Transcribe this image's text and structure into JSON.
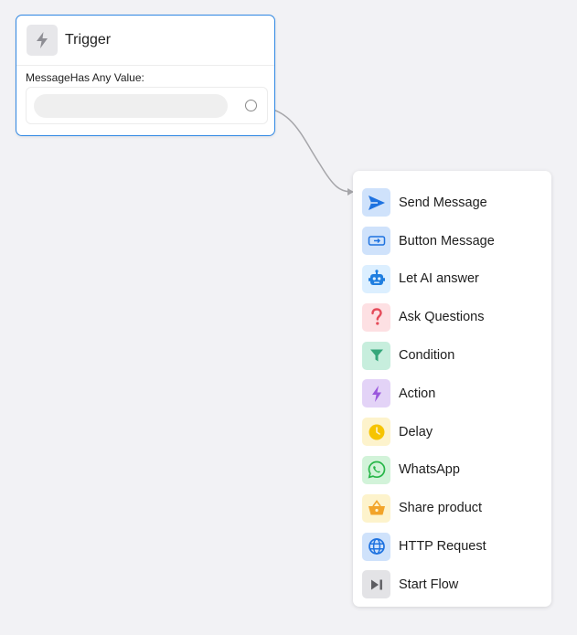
{
  "trigger": {
    "title": "Trigger",
    "condition_label": "MessageHas Any Value:",
    "icon": "bolt-icon"
  },
  "menu": {
    "items": [
      {
        "label": "Send Message",
        "icon": "send-icon",
        "bg": "#cfe2fb",
        "color": "#1e72e0"
      },
      {
        "label": "Button Message",
        "icon": "button-icon",
        "bg": "#cfe2fb",
        "color": "#1e72e0"
      },
      {
        "label": "Let AI answer",
        "icon": "robot-icon",
        "bg": "#dcefff",
        "color": "#1f7ee0"
      },
      {
        "label": "Ask Questions",
        "icon": "question-icon",
        "bg": "#fde0e3",
        "color": "#e54b5a"
      },
      {
        "label": "Condition",
        "icon": "filter-icon",
        "bg": "#c7eedd",
        "color": "#34a77a"
      },
      {
        "label": "Action",
        "icon": "bolt-icon",
        "bg": "#e3d3f7",
        "color": "#9a57dd"
      },
      {
        "label": "Delay",
        "icon": "clock-icon",
        "bg": "#fdf3cc",
        "color": "#f6c400"
      },
      {
        "label": "WhatsApp",
        "icon": "whatsapp-icon",
        "bg": "#d2f3d9",
        "color": "#27b648"
      },
      {
        "label": "Share product",
        "icon": "basket-icon",
        "bg": "#fdf3cc",
        "color": "#f2a42a"
      },
      {
        "label": "HTTP Request",
        "icon": "globe-icon",
        "bg": "#cfe2fb",
        "color": "#1e72e0"
      },
      {
        "label": "Start Flow",
        "icon": "skip-icon",
        "bg": "#e3e3e6",
        "color": "#5d5d62"
      }
    ]
  }
}
